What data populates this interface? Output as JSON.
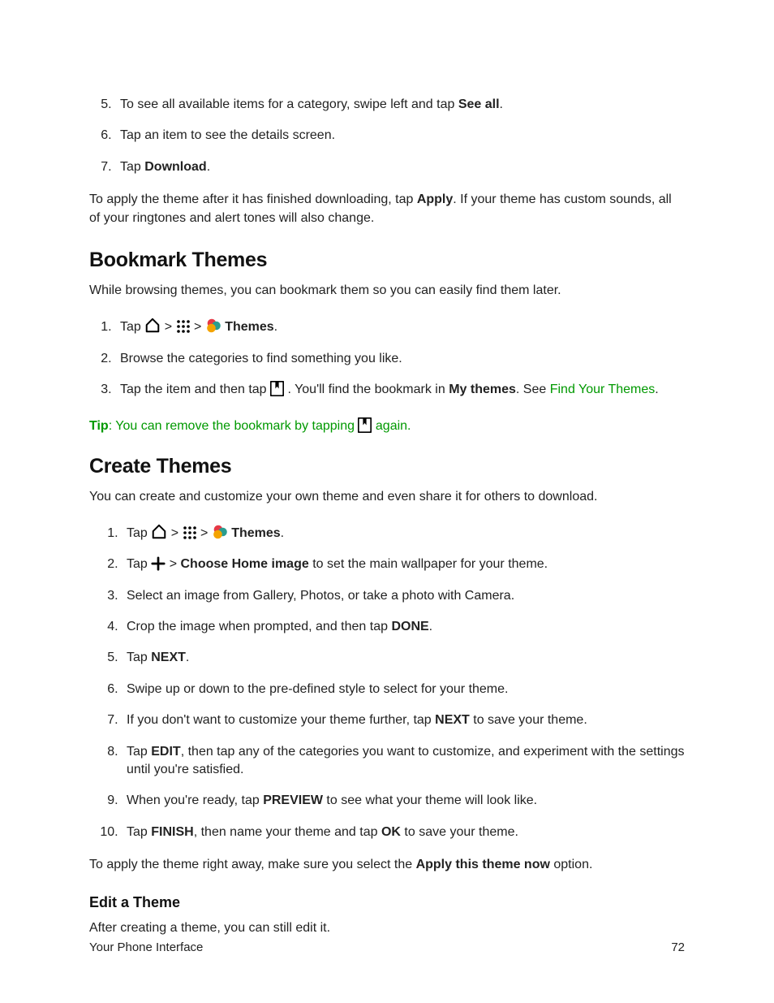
{
  "list1": {
    "i5_a": "To see all available items for a category, swipe left and tap ",
    "i5_b": "See all",
    "i5_c": ".",
    "i6": "Tap an item to see the details screen.",
    "i7_a": "Tap ",
    "i7_b": "Download",
    "i7_c": "."
  },
  "para1_a": "To apply the theme after it has finished downloading, tap ",
  "para1_b": "Apply",
  "para1_c": ". If your theme has custom sounds, all of your ringtones and alert tones will also change.",
  "h_bookmark": "Bookmark Themes",
  "para2": "While browsing themes, you can bookmark them so you can easily find them later.",
  "list2": {
    "i1_a": "Tap ",
    "i1_b": "Themes",
    "i1_c": ".",
    "i2": "Browse the categories to find something you like.",
    "i3_a": "Tap the item and then tap ",
    "i3_b": ". You'll find the bookmark in ",
    "i3_c": "My themes",
    "i3_d": ". See ",
    "i3_link": "Find Your Themes",
    "i3_e": "."
  },
  "tip": {
    "label": "Tip",
    "a": ": You can remove the bookmark by tapping ",
    "b": " again."
  },
  "h_create": "Create Themes",
  "para3": "You can create and customize your own theme and even share it for others to download.",
  "list3": {
    "i1_a": "Tap ",
    "i1_b": "Themes",
    "i1_c": ".",
    "i2_a": "Tap ",
    "i2_b": " > ",
    "i2_c": "Choose Home image",
    "i2_d": " to set the main wallpaper for your theme.",
    "i3": "Select an image from Gallery, Photos, or take a photo with Camera.",
    "i4_a": "Crop the image when prompted, and then tap ",
    "i4_b": "DONE",
    "i4_c": ".",
    "i5_a": "Tap ",
    "i5_b": "NEXT",
    "i5_c": ".",
    "i6": "Swipe up or down to the pre-defined style to select for your theme.",
    "i7_a": "If you don't want to customize your theme further, tap ",
    "i7_b": "NEXT",
    "i7_c": " to save your theme.",
    "i8_a": "Tap ",
    "i8_b": "EDIT",
    "i8_c": ", then tap any of the categories you want to customize, and experiment with the settings until you're satisfied.",
    "i9_a": "When you're ready, tap ",
    "i9_b": "PREVIEW",
    "i9_c": " to see what your theme will look like.",
    "i10_a": "Tap ",
    "i10_b": "FINISH",
    "i10_c": ", then name your theme and tap ",
    "i10_d": "OK",
    "i10_e": " to save your theme."
  },
  "para4_a": "To apply the theme right away, make sure you select the ",
  "para4_b": "Apply this theme now",
  "para4_c": " option.",
  "h_edit": "Edit a Theme",
  "para5": "After creating a theme, you can still edit it.",
  "footer_left": "Your Phone Interface",
  "footer_right": "72"
}
